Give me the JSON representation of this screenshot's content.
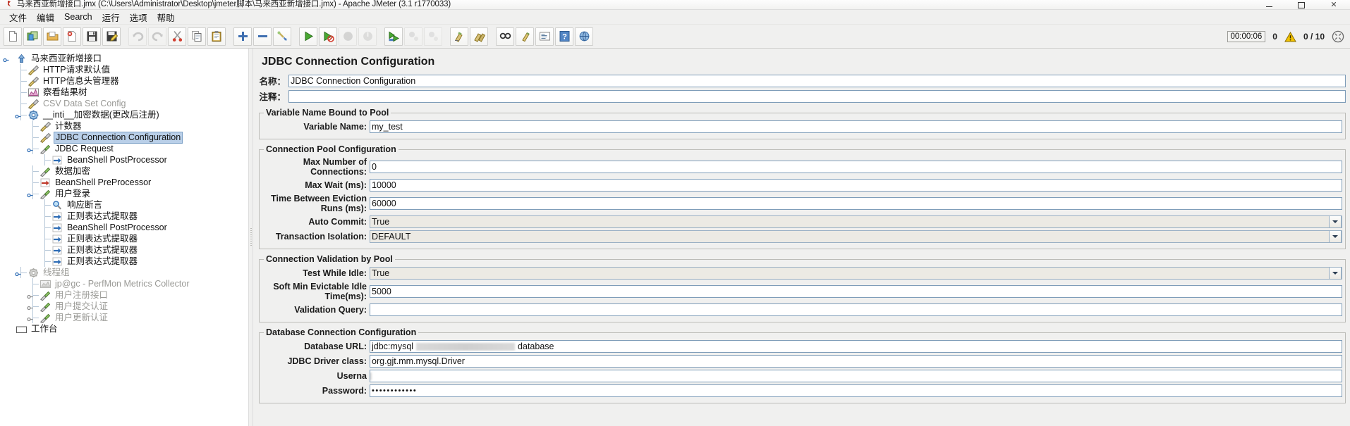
{
  "window": {
    "title": "马来西亚新增接口.jmx (C:\\Users\\Administrator\\Desktop\\jmeter脚本\\马来西亚新增接口.jmx) - Apache JMeter (3.1 r1770033)",
    "minimize_label": "",
    "maximize_label": "",
    "close_label": "✕"
  },
  "menubar": {
    "items": [
      {
        "label": "文件",
        "name": "menu-file"
      },
      {
        "label": "编辑",
        "name": "menu-edit"
      },
      {
        "label": "Search",
        "name": "menu-search"
      },
      {
        "label": "运行",
        "name": "menu-run"
      },
      {
        "label": "选项",
        "name": "menu-options"
      },
      {
        "label": "帮助",
        "name": "menu-help"
      }
    ]
  },
  "toolbar": {
    "buttons": [
      {
        "icon": "new-icon",
        "enabled": true
      },
      {
        "icon": "templates-icon",
        "enabled": true
      },
      {
        "icon": "open-icon",
        "enabled": true
      },
      {
        "icon": "close-icon",
        "enabled": true
      },
      {
        "icon": "save-icon",
        "enabled": true
      },
      {
        "icon": "save-as-icon",
        "enabled": true
      },
      {
        "icon": "undo-icon",
        "enabled": false
      },
      {
        "icon": "redo-icon",
        "enabled": false
      },
      {
        "icon": "cut-icon",
        "enabled": true
      },
      {
        "icon": "copy-icon",
        "enabled": true
      },
      {
        "icon": "paste-icon",
        "enabled": true
      },
      {
        "icon": "expand-all-icon",
        "enabled": true
      },
      {
        "icon": "collapse-all-icon",
        "enabled": true
      },
      {
        "icon": "toggle-icon",
        "enabled": true
      },
      {
        "icon": "start-icon",
        "enabled": true
      },
      {
        "icon": "start-no-pauses-icon",
        "enabled": true
      },
      {
        "icon": "stop-icon",
        "enabled": false
      },
      {
        "icon": "shutdown-icon",
        "enabled": false
      },
      {
        "icon": "remote-start-all-icon",
        "enabled": true
      },
      {
        "icon": "remote-stop-all-icon",
        "enabled": false
      },
      {
        "icon": "remote-shutdown-all-icon",
        "enabled": false
      },
      {
        "icon": "clear-icon",
        "enabled": true
      },
      {
        "icon": "clear-all-icon",
        "enabled": true
      },
      {
        "icon": "search-icon",
        "enabled": true
      },
      {
        "icon": "search-reset-icon",
        "enabled": true
      },
      {
        "icon": "function-helper-icon",
        "enabled": true
      },
      {
        "icon": "help-icon",
        "enabled": true
      },
      {
        "icon": "ssl-manager-icon",
        "enabled": true
      }
    ],
    "status": {
      "elapsed_time": "00:00:06",
      "warning_count": "0",
      "warning_icon": "warning-triangle-icon",
      "threads": "0 / 10",
      "spinner_icon": "activity-indicator-icon"
    }
  },
  "tree": {
    "nodes": [
      {
        "label": "马来西亚新增接口",
        "indent": 0,
        "icon": "test-plan-icon",
        "handle": "expanded",
        "state": "normal"
      },
      {
        "label": "HTTP请求默认值",
        "indent": 1,
        "icon": "config-element-icon",
        "handle": "none",
        "state": "normal"
      },
      {
        "label": "HTTP信息头管理器",
        "indent": 1,
        "icon": "config-element-icon",
        "handle": "none",
        "state": "normal"
      },
      {
        "label": "察看结果树",
        "indent": 1,
        "icon": "view-results-tree-icon",
        "handle": "none",
        "state": "normal"
      },
      {
        "label": "CSV Data Set Config",
        "indent": 1,
        "icon": "config-element-icon",
        "handle": "none",
        "state": "disabled"
      },
      {
        "label": "__inti__加密数据(更改后注册)",
        "indent": 1,
        "icon": "setup-thread-group-icon",
        "handle": "expanded",
        "state": "normal"
      },
      {
        "label": "计数器",
        "indent": 2,
        "icon": "config-element-icon",
        "handle": "none",
        "state": "normal"
      },
      {
        "label": "JDBC Connection Configuration",
        "indent": 2,
        "icon": "config-element-icon",
        "handle": "none",
        "state": "selected"
      },
      {
        "label": "JDBC Request",
        "indent": 2,
        "icon": "sampler-icon",
        "handle": "expanded",
        "state": "normal"
      },
      {
        "label": "BeanShell PostProcessor",
        "indent": 3,
        "icon": "post-processor-icon",
        "handle": "none",
        "state": "normal"
      },
      {
        "label": "数据加密",
        "indent": 2,
        "icon": "sampler-icon",
        "handle": "none",
        "state": "normal"
      },
      {
        "label": "BeanShell PreProcessor",
        "indent": 2,
        "icon": "pre-processor-icon",
        "handle": "none",
        "state": "normal"
      },
      {
        "label": "用户登录",
        "indent": 2,
        "icon": "sampler-icon",
        "handle": "expanded",
        "state": "normal"
      },
      {
        "label": "响应断言",
        "indent": 3,
        "icon": "assertion-icon",
        "handle": "none",
        "state": "normal"
      },
      {
        "label": "正则表达式提取器",
        "indent": 3,
        "icon": "post-processor-icon",
        "handle": "none",
        "state": "normal"
      },
      {
        "label": "BeanShell PostProcessor",
        "indent": 3,
        "icon": "post-processor-icon",
        "handle": "none",
        "state": "normal"
      },
      {
        "label": "正则表达式提取器",
        "indent": 3,
        "icon": "post-processor-icon",
        "handle": "none",
        "state": "normal"
      },
      {
        "label": "正则表达式提取器",
        "indent": 3,
        "icon": "post-processor-icon",
        "handle": "none",
        "state": "normal"
      },
      {
        "label": "正则表达式提取器",
        "indent": 3,
        "icon": "post-processor-icon",
        "handle": "none",
        "state": "normal"
      },
      {
        "label": "线程组",
        "indent": 1,
        "icon": "thread-group-icon",
        "handle": "expanded",
        "state": "disabled"
      },
      {
        "label": "jp@gc - PerfMon Metrics Collector",
        "indent": 2,
        "icon": "listener-icon",
        "handle": "none",
        "state": "disabled"
      },
      {
        "label": "用户注册接口",
        "indent": 2,
        "icon": "sampler-icon",
        "handle": "collapsed",
        "state": "disabled"
      },
      {
        "label": "用户提交认证",
        "indent": 2,
        "icon": "sampler-icon",
        "handle": "collapsed",
        "state": "disabled"
      },
      {
        "label": "用户更新认证",
        "indent": 2,
        "icon": "sampler-icon",
        "handle": "collapsed",
        "state": "disabled"
      },
      {
        "label": "工作台",
        "indent": 0,
        "icon": "workbench-icon",
        "handle": "none",
        "state": "normal"
      }
    ]
  },
  "panel": {
    "title": "JDBC Connection Configuration",
    "name_label": "名称：",
    "name_value": "JDBC Connection Configuration",
    "comment_label": "注释：",
    "comment_value": "",
    "groups": {
      "variable_name_bound_to_pool": {
        "legend": "Variable Name Bound to Pool",
        "rows": [
          {
            "label": "Variable Name:",
            "value": "my_test",
            "type": "text"
          }
        ]
      },
      "connection_pool_configuration": {
        "legend": "Connection Pool Configuration",
        "rows": [
          {
            "label": "Max Number of Connections:",
            "value": "0",
            "type": "text"
          },
          {
            "label": "Max Wait (ms):",
            "value": "10000",
            "type": "text"
          },
          {
            "label": "Time Between Eviction Runs (ms):",
            "value": "60000",
            "type": "text"
          },
          {
            "label": "Auto Commit:",
            "value": "True",
            "type": "combo"
          },
          {
            "label": "Transaction Isolation:",
            "value": "DEFAULT",
            "type": "combo"
          }
        ]
      },
      "connection_validation_by_pool": {
        "legend": "Connection Validation by Pool",
        "rows": [
          {
            "label": "Test While Idle:",
            "value": "True",
            "type": "combo"
          },
          {
            "label": "Soft Min Evictable Idle Time(ms):",
            "value": "5000",
            "type": "text"
          },
          {
            "label": "Validation Query:",
            "value": "",
            "type": "text"
          }
        ]
      },
      "database_connection_configuration": {
        "legend": "Database Connection Configuration",
        "rows": [
          {
            "label": "Database URL:",
            "value": "jdbc:mysql",
            "value_suffix": "database",
            "type": "redacted"
          },
          {
            "label": "JDBC Driver class:",
            "value": "org.gjt.mm.mysql.Driver",
            "type": "text"
          },
          {
            "label": "Userna",
            "value": "",
            "type": "redacted-label"
          },
          {
            "label": "Password:",
            "value": "••••••••••••",
            "type": "text"
          }
        ]
      }
    }
  },
  "colors": {
    "accent": "#b9cfe8",
    "selection_border": "#7ba0c6",
    "field_border": "#7f9db9",
    "panel_bg": "#f0f0ef",
    "warning": "#f2c200",
    "disabled_text": "#9a9a96"
  }
}
